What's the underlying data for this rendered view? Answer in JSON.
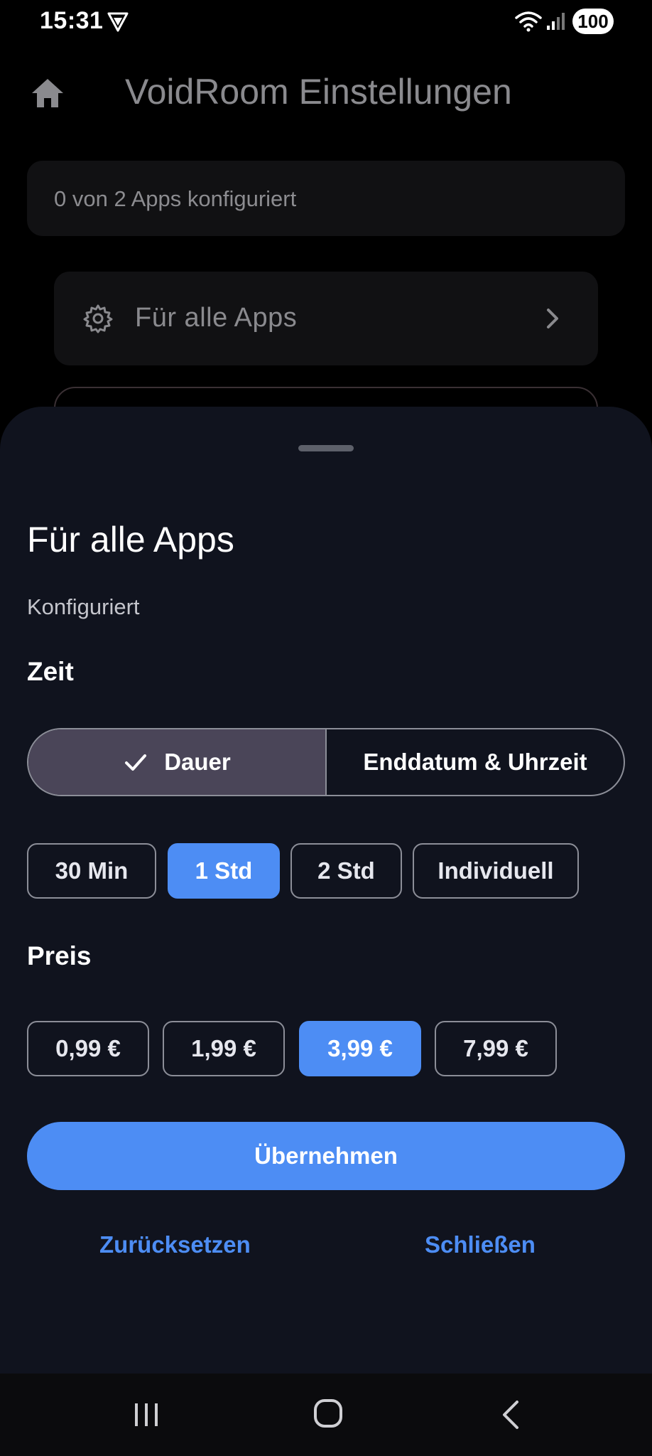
{
  "status_bar": {
    "time": "15:31",
    "battery": "100",
    "icons": [
      "vpn-icon",
      "wifi-icon",
      "signal-icon"
    ]
  },
  "app_bar": {
    "title": "VoidRoom Einstellungen",
    "home_icon": "home-icon"
  },
  "summary": {
    "text": "0 von 2 Apps konfiguriert"
  },
  "all_apps_card": {
    "label": "Für alle Apps",
    "icon": "gear-icon"
  },
  "sheet": {
    "title": "Für alle Apps",
    "subtitle": "Konfiguriert",
    "time_section": {
      "label": "Zeit",
      "mode_options": [
        {
          "label": "Dauer",
          "selected": true
        },
        {
          "label": "Enddatum & Uhrzeit",
          "selected": false
        }
      ],
      "durations": [
        {
          "label": "30 Min",
          "selected": false
        },
        {
          "label": "1 Std",
          "selected": true
        },
        {
          "label": "2 Std",
          "selected": false
        },
        {
          "label": "Individuell",
          "selected": false
        }
      ]
    },
    "price_section": {
      "label": "Preis",
      "prices": [
        {
          "label": "0,99 €",
          "selected": false
        },
        {
          "label": "1,99 €",
          "selected": false
        },
        {
          "label": "3,99 €",
          "selected": true
        },
        {
          "label": "7,99 €",
          "selected": false
        }
      ]
    },
    "apply_label": "Übernehmen",
    "reset_label": "Zurücksetzen",
    "close_label": "Schließen"
  },
  "colors": {
    "accent": "#4d8df4",
    "sheet_background": "#10131e",
    "selected_segment": "#4a4558"
  }
}
